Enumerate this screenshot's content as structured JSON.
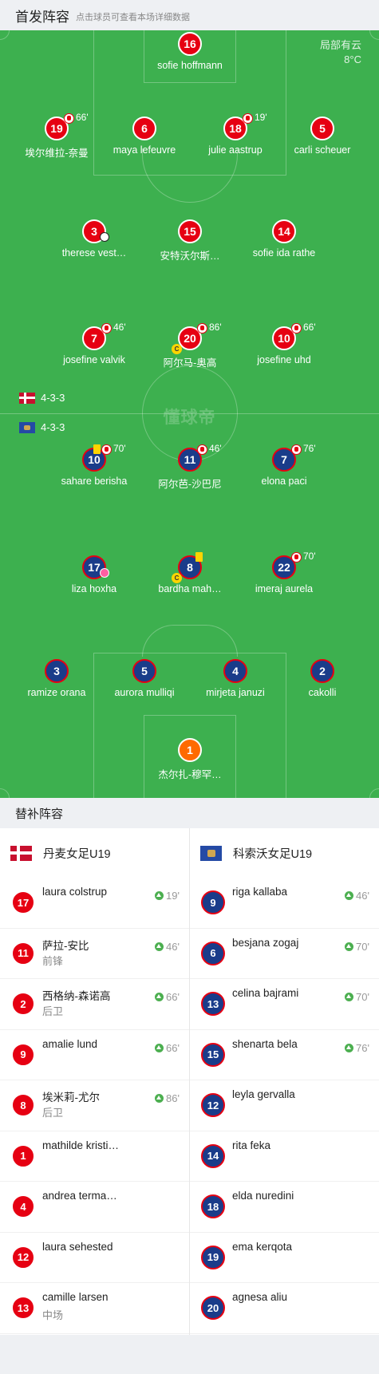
{
  "header": {
    "title": "首发阵容",
    "subtitle": "点击球员可查看本场详细数据"
  },
  "weather": {
    "condition": "局部有云",
    "temperature": "8°C"
  },
  "watermark": "懂球帝",
  "formations": {
    "home": "4-3-3",
    "away": "4-3-3"
  },
  "home_lineup": {
    "gk": {
      "number": "16",
      "name": "sofie hoffmann"
    },
    "p19": {
      "number": "19",
      "name": "埃尔维拉-奈曼",
      "sub": "66'"
    },
    "p6": {
      "number": "6",
      "name": "maya lefeuvre"
    },
    "p18": {
      "number": "18",
      "name": "julie aastrup",
      "sub": "19'"
    },
    "p5": {
      "number": "5",
      "name": "carli scheuer"
    },
    "p3": {
      "number": "3",
      "name": "therese vest…"
    },
    "p15": {
      "number": "15",
      "name": "安特沃尔斯…"
    },
    "p14": {
      "number": "14",
      "name": "sofie ida rathe"
    },
    "p7": {
      "number": "7",
      "name": "josefine valvik",
      "sub": "46'"
    },
    "p20": {
      "number": "20",
      "name": "阿尔马-奥高",
      "sub": "86'",
      "captain": "C"
    },
    "p10": {
      "number": "10",
      "name": "josefine uhd",
      "sub": "66'"
    }
  },
  "away_lineup": {
    "p10": {
      "number": "10",
      "name": "sahare berisha",
      "sub": "70'"
    },
    "p11": {
      "number": "11",
      "name": "阿尔芭-沙巴尼",
      "sub": "46'"
    },
    "p7": {
      "number": "7",
      "name": "elona paci",
      "sub": "76'"
    },
    "p17": {
      "number": "17",
      "name": "liza hoxha"
    },
    "p8": {
      "number": "8",
      "name": "bardha mah…",
      "captain": "C"
    },
    "p22": {
      "number": "22",
      "name": "imeraj aurela",
      "sub": "70'"
    },
    "p3": {
      "number": "3",
      "name": "ramize orana"
    },
    "p5": {
      "number": "5",
      "name": "aurora mulliqi"
    },
    "p4": {
      "number": "4",
      "name": "mirjeta januzi"
    },
    "p2": {
      "number": "2",
      "name": "cakolli"
    },
    "gk": {
      "number": "1",
      "name": "杰尔扎-穆罕…"
    }
  },
  "bench_header": "替补阵容",
  "bench": {
    "home": {
      "team": "丹麦女足U19",
      "players": [
        {
          "number": "17",
          "name": "laura colstrup",
          "position": "",
          "in": "19'"
        },
        {
          "number": "11",
          "name": "萨拉-安比",
          "position": "前锋",
          "in": "46'"
        },
        {
          "number": "2",
          "name": "西格纳-森诺高",
          "position": "后卫",
          "in": "66'"
        },
        {
          "number": "9",
          "name": "amalie lund",
          "position": "",
          "in": "66'"
        },
        {
          "number": "8",
          "name": "埃米莉-尤尔",
          "position": "后卫",
          "in": "86'"
        },
        {
          "number": "1",
          "name": "mathilde kristi…",
          "position": "",
          "in": ""
        },
        {
          "number": "4",
          "name": "andrea terma…",
          "position": "",
          "in": ""
        },
        {
          "number": "12",
          "name": "laura sehested",
          "position": "",
          "in": ""
        },
        {
          "number": "13",
          "name": "camille larsen",
          "position": "中场",
          "in": ""
        }
      ]
    },
    "away": {
      "team": "科索沃女足U19",
      "players": [
        {
          "number": "9",
          "name": "riga kallaba",
          "position": "",
          "in": "46'"
        },
        {
          "number": "6",
          "name": "besjana zogaj",
          "position": "",
          "in": "70'"
        },
        {
          "number": "13",
          "name": "celina bajrami",
          "position": "",
          "in": "70'"
        },
        {
          "number": "15",
          "name": "shenarta bela",
          "position": "",
          "in": "76'"
        },
        {
          "number": "12",
          "name": "leyla gervalla",
          "position": "",
          "in": ""
        },
        {
          "number": "14",
          "name": "rita feka",
          "position": "",
          "in": ""
        },
        {
          "number": "18",
          "name": "elda nuredini",
          "position": "",
          "in": ""
        },
        {
          "number": "19",
          "name": "ema kerqota",
          "position": "",
          "in": ""
        },
        {
          "number": "20",
          "name": "agnesa aliu",
          "position": "",
          "in": ""
        }
      ]
    }
  },
  "colors": {
    "pitch": "#3db04f",
    "home": "#e60012",
    "away": "#1a3c8a",
    "gk_away": "#ff6a00",
    "sub_in": "#4caf50"
  }
}
